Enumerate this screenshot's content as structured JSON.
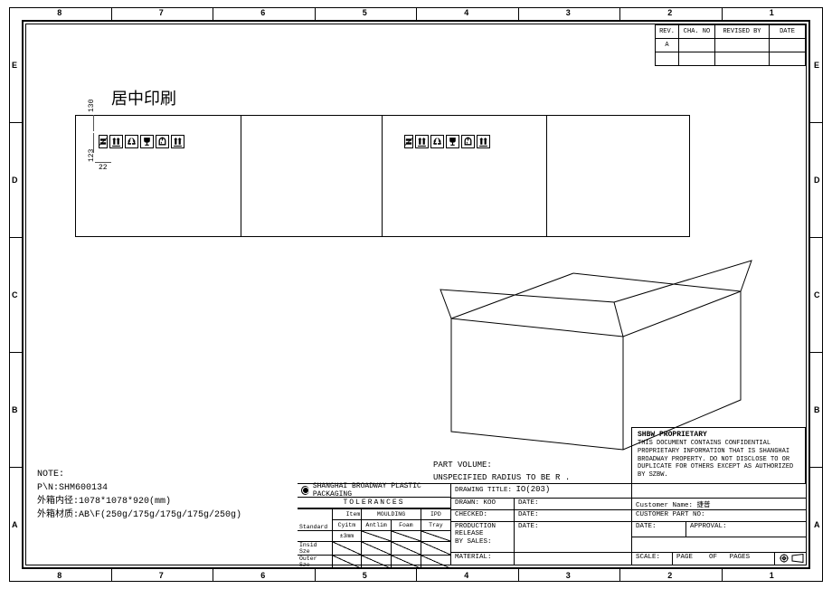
{
  "ruler": {
    "cols": [
      "8",
      "7",
      "6",
      "5",
      "4",
      "3",
      "2",
      "1"
    ],
    "rows": [
      "E",
      "D",
      "C",
      "B",
      "A"
    ]
  },
  "rev_block": {
    "headers": [
      "REV.",
      "CHA. NO",
      "REVISED BY",
      "DATE"
    ],
    "row": [
      "A",
      "",
      "",
      ""
    ]
  },
  "flat": {
    "label": "居中印刷",
    "dims": {
      "d1": "130",
      "d2": "123",
      "d3": "22"
    }
  },
  "notes": {
    "title": "NOTE:",
    "pn": "P\\N:SHM600134",
    "size": "外箱内径:1078*1078*920(mm)",
    "mat": "外箱材质:AB\\F(250g/175g/175g/175g/250g)"
  },
  "part": {
    "vol": "PART VOLUME:",
    "rad": "UNSPECIFIED RADIUS TO BE R ."
  },
  "proprietary": {
    "title": "SHBW PROPRIETARY",
    "body": "THIS DOCUMENT CONTAINS CONFIDENTIAL PROPRIETARY INFORMATION THAT IS SHANGHAI BROADWAY PROPERTY. DO NOT DISCLOSE TO OR DUPLICATE FOR OTHERS EXCEPT AS AUTHORIZED BY SZBW."
  },
  "title_block": {
    "company": "SHANGHAI BROADWAY PLASTIC PACKAGING",
    "tol_title": "TOLERANCES",
    "tol": {
      "cols": [
        "Item",
        "MOULDING",
        "IPD"
      ],
      "sub": [
        "Standard",
        "Cyitm",
        "Antlim",
        "Foam",
        "Tray"
      ],
      "rows": [
        {
          "label": "",
          "v": [
            "±3mm",
            "",
            "",
            ""
          ]
        },
        {
          "label": "Insid Sze",
          "v": [
            "",
            "",
            "",
            ""
          ]
        },
        {
          "label": "Outer Sze",
          "v": [
            "",
            "",
            "",
            ""
          ]
        }
      ]
    },
    "drawing_title_lbl": "DRAWING TITLE:",
    "drawing_title_val": "IO(203)",
    "drawn_lbl": "DRAWN:",
    "drawn_val": "KOO",
    "date_lbl": "DATE:",
    "checked_lbl": "CHECKED:",
    "prod_lbl": "PRODUCTION\nRELEASE\nBY SALES:",
    "material_lbl": "MATERIAL:",
    "cust_name_lbl": "Customer Name:",
    "cust_name_val": "捷普",
    "cust_part_lbl": "CUSTOMER PART NO:",
    "approval_lbl": "APPROVAL:",
    "scale_lbl": "SCALE:",
    "page_lbl": "PAGE",
    "of_lbl": "OF",
    "pages_lbl": "PAGES"
  }
}
